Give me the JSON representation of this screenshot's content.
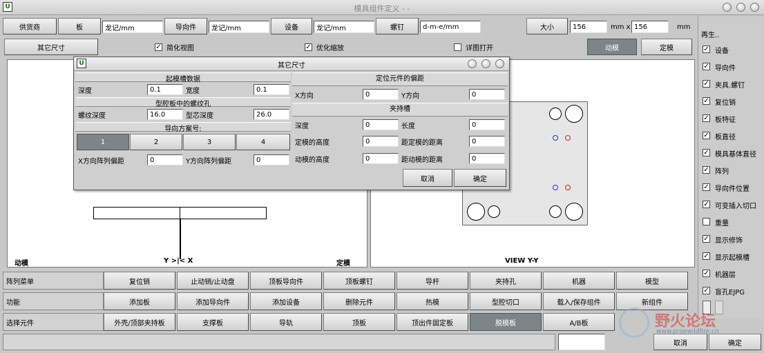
{
  "window": {
    "title": "模具组件定义 - -"
  },
  "toolbar1": {
    "supplier_btn": "供货商",
    "board_btn": "板",
    "board_value": "龙记/mm",
    "guide_btn": "导向件",
    "guide_value": "龙记/mm",
    "equip_btn": "设备",
    "equip_value": "龙记/mm",
    "screw_btn": "螺钉",
    "screw_value": "d-m-e/mm",
    "size_btn": "大小",
    "size_w": "156",
    "size_unit1": "mm x",
    "size_h": "156",
    "size_unit2": "mm"
  },
  "toolbar2": {
    "other_size_btn": "其它尺寸",
    "simplify_view": "简化视图",
    "optimize_zoom": "优化缩放",
    "detail_open": "详图打开",
    "moving_btn": "动模",
    "fixed_btn": "定模"
  },
  "canvas": {
    "left_label_moving": "动模",
    "left_label_axis": "Y >|< X",
    "left_label_fixed": "定模",
    "right_label_view": "VIEW Y-Y"
  },
  "dialog": {
    "title": "其它尺寸",
    "lift_slot_header": "起模槽数据",
    "depth_label": "深度",
    "depth_value": "0.1",
    "width_label": "宽度",
    "width_value": "0.1",
    "cavity_screw_header": "型腔板中的螺纹孔",
    "thread_depth_label": "螺纹深度",
    "thread_depth_value": "16.0",
    "core_depth_label": "型芯深度",
    "core_depth_value": "26.0",
    "guide_scheme_header": "导向方案号:",
    "scheme_buttons": [
      "1",
      "2",
      "3",
      "4"
    ],
    "x_offset_label": "X方向阵列偏距",
    "x_offset_value": "0",
    "y_offset_label": "Y方向阵列偏距",
    "y_offset_value": "0",
    "locate_header": "定位元件的偏距",
    "x_dir_label": "X方向",
    "x_dir_value": "0",
    "y_dir_label": "Y方向",
    "y_dir_value": "0",
    "clamp_header": "夹持槽",
    "clamp_depth_label": "深度",
    "clamp_depth_value": "0",
    "clamp_length_label": "长度",
    "clamp_length_value": "0",
    "fixed_height_label": "定模的高度",
    "fixed_height_value": "0",
    "fixed_dist_label": "距定模的距离",
    "fixed_dist_value": "0",
    "moving_height_label": "动模的高度",
    "moving_height_value": "0",
    "moving_dist_label": "距动模的距离",
    "moving_dist_value": "0",
    "cancel_btn": "取消",
    "ok_btn": "确定"
  },
  "right_panel": {
    "header": "再生..",
    "items": [
      {
        "label": "设备",
        "checked": true
      },
      {
        "label": "导向件",
        "checked": true
      },
      {
        "label": "夹具.螺钉",
        "checked": true
      },
      {
        "label": "复位销",
        "checked": true
      },
      {
        "label": "板特征",
        "checked": true
      },
      {
        "label": "板直径",
        "checked": true
      },
      {
        "label": "模具基体直径",
        "checked": true
      },
      {
        "label": "阵列",
        "checked": true
      },
      {
        "label": "导向件位置",
        "checked": true
      },
      {
        "label": "可变插入切口",
        "checked": true
      },
      {
        "label": "重量",
        "checked": false
      },
      {
        "label": "显示修饰",
        "checked": true
      },
      {
        "label": "显示起模槽",
        "checked": true
      },
      {
        "label": "机器层",
        "checked": true
      },
      {
        "label": "盲孔EJPG",
        "checked": true
      }
    ]
  },
  "bottom": {
    "row1_label": "阵列菜单",
    "row1": [
      "复位销",
      "止动销/止动盘",
      "顶板导向件",
      "顶板螺钉",
      "导杆",
      "夹持孔",
      "机器",
      "模型"
    ],
    "row2_label": "功能",
    "row2": [
      "添加板",
      "添加导向件",
      "添加设备",
      "删除元件",
      "热模",
      "型腔切口",
      "载入/保存组件",
      "新组件"
    ],
    "row3_label": "选择元件",
    "row3": [
      "外壳/顶部夹持板",
      "支撑板",
      "导轨",
      "顶板",
      "顶出件固定板",
      "脱模板",
      "A/B板"
    ],
    "cancel_btn": "取消",
    "ok_btn": "确定",
    "watermark_text": "野火论坛",
    "watermark_url": "www.proewildfire.cn"
  },
  "colors": {
    "active_button": "#7d8589",
    "hole_blue": "#2233cc",
    "hole_red": "#cc2222"
  }
}
